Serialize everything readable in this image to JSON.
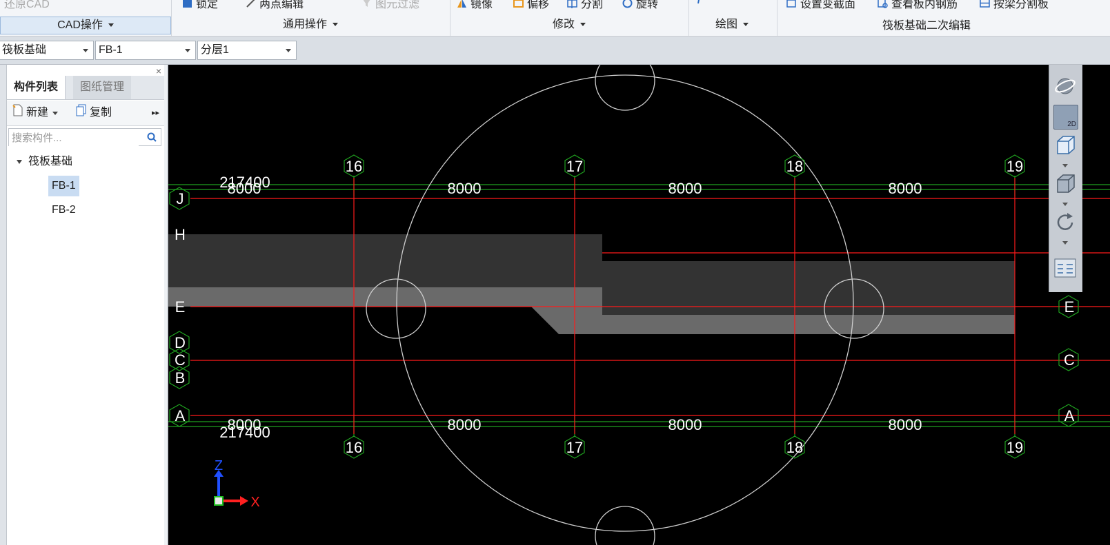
{
  "ribbon": {
    "tools": {
      "restore_cad": "还原CAD",
      "lock": "锁定",
      "two_point_edit": "两点编辑",
      "element_filter": "图元过滤",
      "mirror": "镜像",
      "offset": "偏移",
      "split": "分割",
      "rotate": "旋转",
      "set_variable_section": "设置变截面",
      "view_slab_rebar": "查看板内钢筋",
      "split_by_beam": "按梁分割板"
    },
    "groups": {
      "cad": "CAD操作",
      "general": "通用操作",
      "modify": "修改",
      "draw": "绘图",
      "raft_edit": "筏板基础二次编辑"
    }
  },
  "selectors": {
    "category": "筏板基础",
    "component": "FB-1",
    "layer": "分层1"
  },
  "left_panel": {
    "close": "×",
    "tabs": {
      "component_list": "构件列表",
      "drawing_manage": "图纸管理"
    },
    "toolbar": {
      "new": "新建",
      "copy": "复制",
      "more": "▸▸"
    },
    "search_placeholder": "搜索构件...",
    "tree": {
      "root": "筏板基础",
      "items": [
        "FB-1",
        "FB-2"
      ]
    }
  },
  "drawing": {
    "axis_numbers": [
      "16",
      "17",
      "18",
      "19"
    ],
    "axis_letters_left": [
      "J",
      "H",
      "E",
      "D",
      "C",
      "B",
      "A"
    ],
    "axis_letters_right": [
      "E",
      "C",
      "A"
    ],
    "spans": [
      "8000",
      "8000",
      "8000",
      "8000"
    ],
    "total": "217400",
    "ucs": {
      "z": "Z",
      "x": "X"
    },
    "colors": {
      "background": "#000000",
      "axis_line": "#ff1a1a",
      "dim_line": "#1fa01f",
      "slab_dark": "#333333",
      "slab_light": "#6a6a6a",
      "circle": "#cfcfcf"
    }
  },
  "viewbar": {
    "dynamic_observe_icon": "orbit-icon",
    "two_d": "2D",
    "three_d_icon": "cube-icon",
    "rotate_icon": "rotate-icon",
    "layer_icon": "layer-control-icon"
  }
}
